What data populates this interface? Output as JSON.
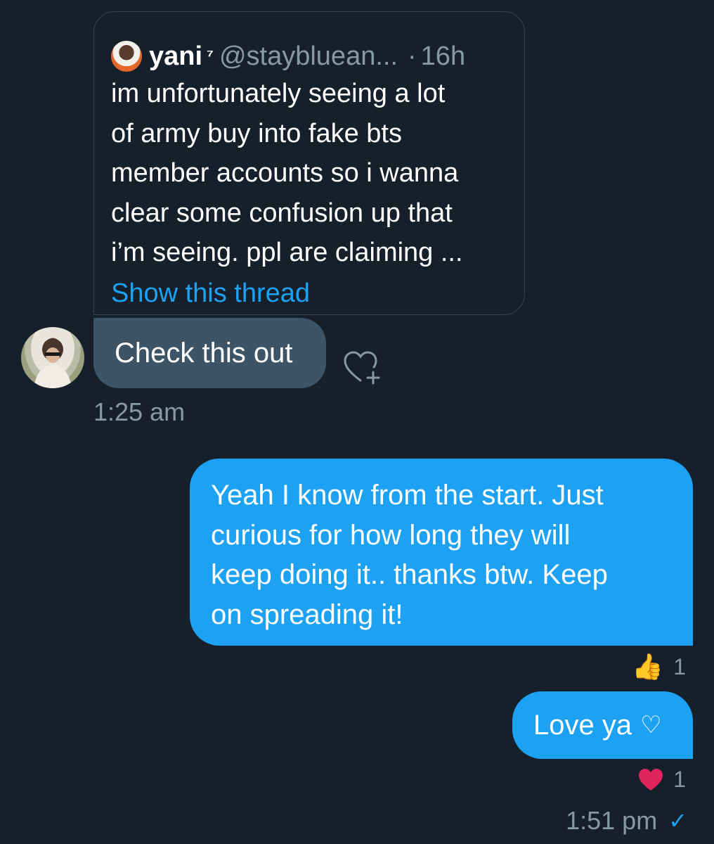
{
  "quoted_tweet": {
    "display_name": "yani",
    "name_suffix": "⁷",
    "handle": "@staybluean...",
    "separator": "·",
    "time_ago": "16h",
    "lines": [
      "im unfortunately seeing a lot",
      "of army buy into fake bts",
      "member accounts so i wanna",
      "clear some confusion up that",
      "i’m seeing. ppl are claiming ..."
    ],
    "thread_link": "Show this thread"
  },
  "messages": [
    {
      "direction": "incoming",
      "text": "Check this out",
      "time": "1:25 am"
    },
    {
      "direction": "outgoing",
      "lines": [
        "Yeah I know from the start. Just",
        "curious for how long they will",
        "keep doing it.. thanks btw. Keep",
        "on spreading it!"
      ],
      "reaction": {
        "icon": "thumbs-up-icon",
        "emoji": "👍",
        "count": "1"
      }
    },
    {
      "direction": "outgoing",
      "text": "Love ya",
      "text_icon": "♡",
      "reaction": {
        "icon": "red-heart-icon",
        "count": "1"
      },
      "time": "1:51 pm",
      "status_icon": "✓"
    }
  ],
  "colors": {
    "background": "#15202b",
    "accent": "#1da1f2",
    "incoming_bubble": "#3d5466",
    "muted": "#8899a6",
    "border": "#38444d",
    "heart": "#e0245e"
  }
}
